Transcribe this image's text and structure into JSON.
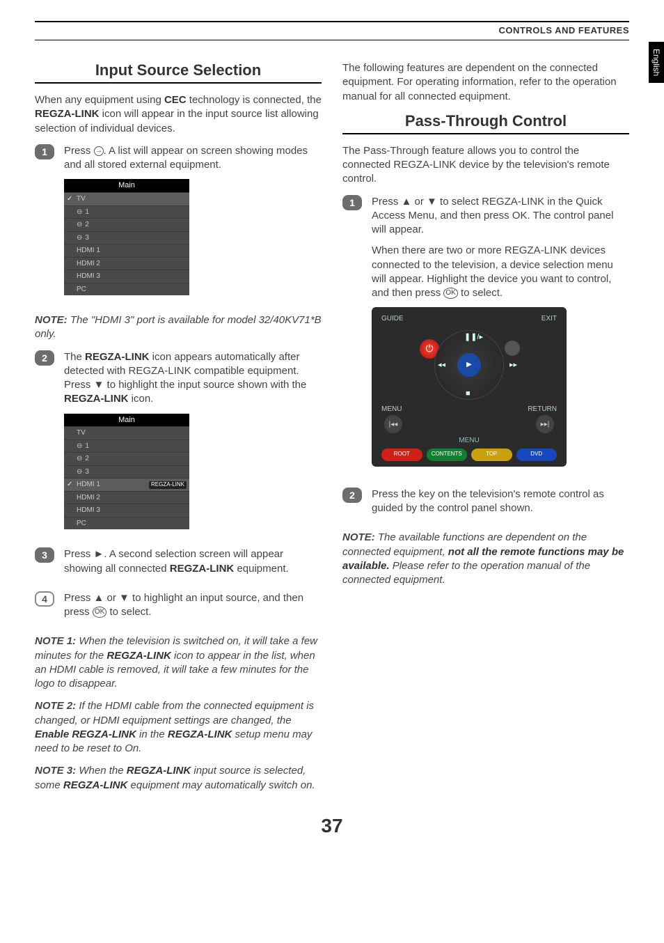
{
  "header": {
    "section": "CONTROLS AND FEATURES"
  },
  "lang_tab": "English",
  "left": {
    "title": "Input Source Selection",
    "intro_parts": [
      "When any equipment using ",
      "CEC",
      " technology is connected, the ",
      "REGZA-LINK",
      " icon will appear in the input source list allowing selection of individual devices."
    ],
    "step1": "Press      . A list will appear on screen showing modes and all stored external equipment.",
    "osd1": {
      "title": "Main",
      "rows": [
        "TV",
        "1",
        "2",
        "3",
        "HDMI 1",
        "HDMI 2",
        "HDMI 3",
        "PC"
      ],
      "selected": 0
    },
    "note_hdmi": {
      "lead": "NOTE:",
      "text": " The \"HDMI 3\" port is available for model 32/40KV71*B only."
    },
    "step2_parts": [
      "The ",
      "REGZA-LINK",
      " icon appears automatically after detected with REGZA-LINK compatible equipment. Press ▼ to highlight the input source shown with the ",
      "REGZA-LINK",
      " icon."
    ],
    "osd2": {
      "title": "Main",
      "rows": [
        "TV",
        "1",
        "2",
        "3",
        "HDMI 1",
        "HDMI 2",
        "HDMI 3",
        "PC"
      ],
      "selected": 4,
      "badge": "REGZA-LINK"
    },
    "step3_parts": [
      "Press ►. A second selection screen will appear showing all connected ",
      "REGZA-LINK",
      " equipment."
    ],
    "step4": "Press ▲ or ▼ to highlight an input source, and then press     to select.",
    "note1": {
      "lead": "NOTE 1:",
      "text": " When the television is switched on, it will take a few minutes for the ",
      "b": "REGZA-LINK",
      "text2": " icon to appear in the list, when an HDMI cable is removed, it will take a few minutes for the logo to disappear."
    },
    "note2": {
      "lead": "NOTE 2:",
      "text": " If the HDMI cable from the connected equipment is changed, or HDMI equipment settings are changed, the ",
      "b1": "Enable REGZA-LINK",
      "mid": " in the ",
      "b2": "REGZA-LINK",
      "text2": " setup menu may need to be reset to On."
    },
    "note3": {
      "lead": "NOTE 3:",
      "text": " When the ",
      "b1": "REGZA-LINK",
      "mid": " input source is selected, some ",
      "b2": "REGZA-LINK",
      "text2": " equipment may automatically switch on."
    }
  },
  "right": {
    "intro": "The following features are dependent on the connected equipment. For operating information, refer to the operation manual for all connected equipment.",
    "title": "Pass-Through Control",
    "lead": "The Pass-Through feature allows you to control the connected REGZA-LINK device by the television's remote control.",
    "step1a": "Press ▲ or ▼ to select REGZA-LINK in the Quick Access Menu, and then press OK. The control panel will appear.",
    "step1b": "When there are two or more REGZA-LINK devices connected to the television, a device selection menu will appear. Highlight the device you want to control, and then press     to select.",
    "panel": {
      "guide": "GUIDE",
      "exit": "EXIT",
      "menu": "MENU",
      "return": "RETURN",
      "menulbl": "MENU",
      "root": "ROOT",
      "contents": "CONTENTS",
      "top": "TOP",
      "dvd": "DVD"
    },
    "step2": "Press the key on the television's remote control as guided by the control panel shown.",
    "note": {
      "lead": "NOTE:",
      "t1": " The available functions are dependent on the connected equipment, ",
      "b": "not all the remote functions may be available.",
      "t2": " Please refer to the operation manual of the connected equipment."
    }
  },
  "page_number": "37"
}
